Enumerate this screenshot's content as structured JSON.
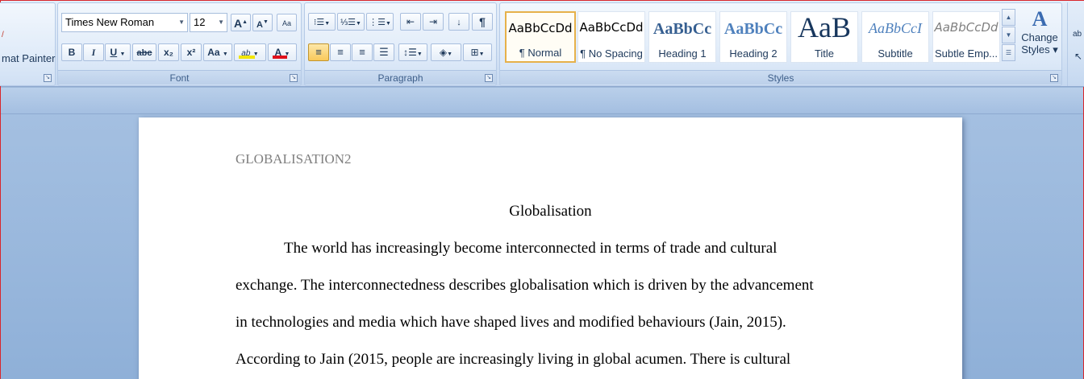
{
  "clipboard": {
    "format_painter_label": "mat Painter"
  },
  "font": {
    "group_label": "Font",
    "family": "Times New Roman",
    "size": "12",
    "grow_label": "A",
    "shrink_label": "A",
    "clear_label": "Aa",
    "bold": "B",
    "italic": "I",
    "underline": "U",
    "strikethrough": "abc",
    "subscript": "x₂",
    "superscript": "x²",
    "change_case": "Aa",
    "highlight_label": "ab",
    "font_color_label": "A",
    "highlight_color": "#f2e600",
    "font_color": "#e0101a"
  },
  "paragraph": {
    "group_label": "Paragraph"
  },
  "styles": {
    "group_label": "Styles",
    "items": [
      {
        "preview": "AaBbCcDd",
        "name": "¶ Normal"
      },
      {
        "preview": "AaBbCcDd",
        "name": "¶ No Spacing"
      },
      {
        "preview": "AaBbCc",
        "name": "Heading 1"
      },
      {
        "preview": "AaBbCc",
        "name": "Heading 2"
      },
      {
        "preview": "AaB",
        "name": "Title"
      },
      {
        "preview": "AaBbCcI",
        "name": "Subtitle"
      },
      {
        "preview": "AaBbCcDd",
        "name": "Subtle Emp..."
      }
    ],
    "change_styles_line1": "Change",
    "change_styles_line2": "Styles",
    "accent_color": "#e6b14a"
  },
  "document": {
    "header": "GLOBALISATION2",
    "title": "Globalisation",
    "lines": [
      "The world has increasingly become interconnected in terms of trade and cultural",
      "exchange.  The  interconnectedness describes globalisation which is driven by the advancement",
      "in technologies and media which have shaped lives and modified behaviours (Jain, 2015).",
      "According to Jain (2015, people are increasingly living in global acumen. There is cultural"
    ]
  }
}
